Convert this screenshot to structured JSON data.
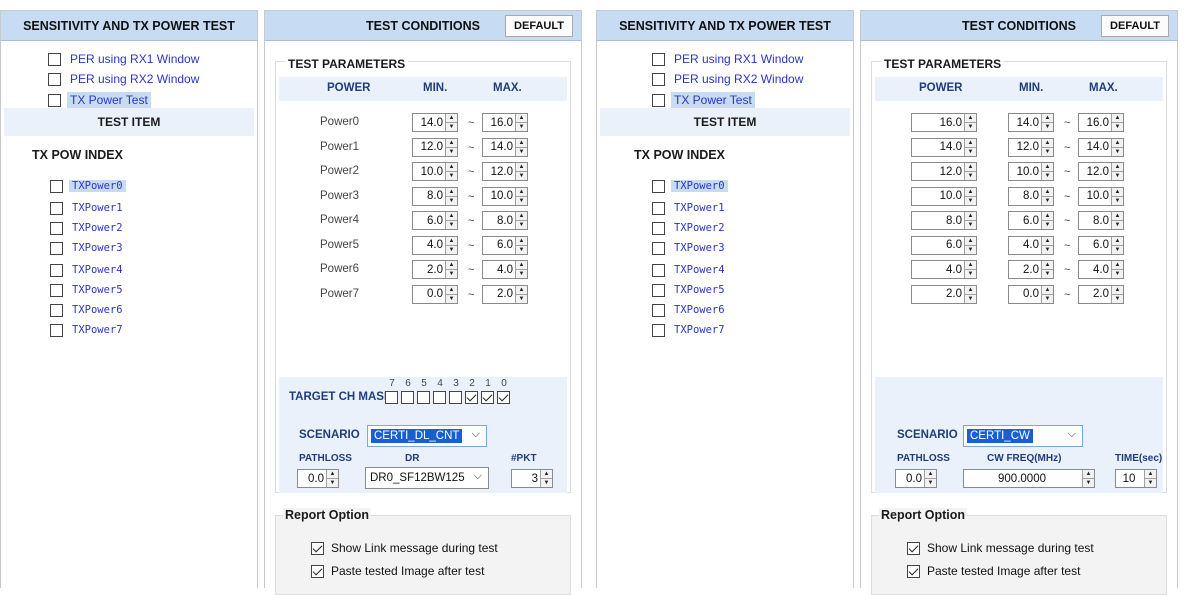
{
  "panes": [
    {
      "id": "a",
      "left_header": "SENSITIVITY AND TX POWER TEST",
      "test_options": [
        {
          "label": "PER using RX1 Window",
          "checked": false,
          "selected": false
        },
        {
          "label": "PER using RX2 Window",
          "checked": false,
          "selected": false
        },
        {
          "label": "TX Power Test",
          "checked": false,
          "selected": true
        }
      ],
      "test_item_header": "TEST ITEM",
      "tx_pow_index_title": "TX POW INDEX",
      "tx_items": [
        {
          "label": "TXPower0",
          "checked": false,
          "selected": true
        },
        {
          "label": "TXPower1",
          "checked": false,
          "selected": false
        },
        {
          "label": "TXPower2",
          "checked": false,
          "selected": false
        },
        {
          "label": "TXPower3",
          "checked": false,
          "selected": false
        },
        {
          "label": "TXPower4",
          "checked": false,
          "selected": false
        },
        {
          "label": "TXPower5",
          "checked": false,
          "selected": false
        },
        {
          "label": "TXPower6",
          "checked": false,
          "selected": false
        },
        {
          "label": "TXPower7",
          "checked": false,
          "selected": false
        }
      ],
      "right_header": "TEST CONDITIONS",
      "default_button": "DEFAULT",
      "params_title": "TEST PARAMETERS",
      "col_power": "POWER",
      "col_min": "MIN.",
      "col_max": "MAX.",
      "power_rows": [
        {
          "name": "Power0",
          "min": "14.0",
          "max": "16.0"
        },
        {
          "name": "Power1",
          "min": "12.0",
          "max": "14.0"
        },
        {
          "name": "Power2",
          "min": "10.0",
          "max": "12.0"
        },
        {
          "name": "Power3",
          "min": "8.0",
          "max": "10.0"
        },
        {
          "name": "Power4",
          "min": "6.0",
          "max": "8.0"
        },
        {
          "name": "Power5",
          "min": "4.0",
          "max": "6.0"
        },
        {
          "name": "Power6",
          "min": "2.0",
          "max": "4.0"
        },
        {
          "name": "Power7",
          "min": "0.0",
          "max": "2.0"
        }
      ],
      "tilde": "~",
      "target_ch_mask_label": "TARGET CH MASK",
      "mask_bits": [
        {
          "num": "7",
          "checked": false
        },
        {
          "num": "6",
          "checked": false
        },
        {
          "num": "5",
          "checked": false
        },
        {
          "num": "4",
          "checked": false
        },
        {
          "num": "3",
          "checked": false
        },
        {
          "num": "2",
          "checked": true
        },
        {
          "num": "1",
          "checked": true
        },
        {
          "num": "0",
          "checked": true
        }
      ],
      "scenario_label": "SCENARIO",
      "scenario_value": "CERTI_DL_CNT",
      "pathloss_label": "PATHLOSS",
      "pathloss_value": "0.0",
      "dr_label": "DR",
      "dr_value": "DR0_SF12BW125",
      "pkt_label": "#PKT",
      "pkt_value": "3",
      "report_title": "Report Option",
      "report_options": [
        {
          "label": "Show Link message during test",
          "checked": true
        },
        {
          "label": "Paste tested Image after test",
          "checked": true
        }
      ]
    },
    {
      "id": "b",
      "left_header": "SENSITIVITY AND TX POWER TEST",
      "test_options": [
        {
          "label": "PER using RX1 Window",
          "checked": false,
          "selected": false
        },
        {
          "label": "PER using RX2 Window",
          "checked": false,
          "selected": false
        },
        {
          "label": "TX Power Test",
          "checked": false,
          "selected": true
        }
      ],
      "test_item_header": "TEST ITEM",
      "tx_pow_index_title": "TX POW INDEX",
      "tx_items": [
        {
          "label": "TXPower0",
          "checked": false,
          "selected": true
        },
        {
          "label": "TXPower1",
          "checked": false,
          "selected": false
        },
        {
          "label": "TXPower2",
          "checked": false,
          "selected": false
        },
        {
          "label": "TXPower3",
          "checked": false,
          "selected": false
        },
        {
          "label": "TXPower4",
          "checked": false,
          "selected": false
        },
        {
          "label": "TXPower5",
          "checked": false,
          "selected": false
        },
        {
          "label": "TXPower6",
          "checked": false,
          "selected": false
        },
        {
          "label": "TXPower7",
          "checked": false,
          "selected": false
        }
      ],
      "right_header": "TEST CONDITIONS",
      "default_button": "DEFAULT",
      "params_title": "TEST PARAMETERS",
      "col_power": "POWER",
      "col_min": "MIN.",
      "col_max": "MAX.",
      "power_rows": [
        {
          "power": "16.0",
          "min": "14.0",
          "max": "16.0"
        },
        {
          "power": "14.0",
          "min": "12.0",
          "max": "14.0"
        },
        {
          "power": "12.0",
          "min": "10.0",
          "max": "12.0"
        },
        {
          "power": "10.0",
          "min": "8.0",
          "max": "10.0"
        },
        {
          "power": "8.0",
          "min": "6.0",
          "max": "8.0"
        },
        {
          "power": "6.0",
          "min": "4.0",
          "max": "6.0"
        },
        {
          "power": "4.0",
          "min": "2.0",
          "max": "4.0"
        },
        {
          "power": "2.0",
          "min": "0.0",
          "max": "2.0"
        }
      ],
      "tilde": "~",
      "scenario_label": "SCENARIO",
      "scenario_value": "CERTI_CW",
      "pathloss_label": "PATHLOSS",
      "pathloss_value": "0.0",
      "cw_freq_label": "CW FREQ(MHz)",
      "cw_freq_value": "900.0000",
      "time_label": "TIME(sec)",
      "time_value": "10",
      "report_title": "Report Option",
      "report_options": [
        {
          "label": "Show Link message during test",
          "checked": true
        },
        {
          "label": "Paste tested Image after test",
          "checked": true
        }
      ]
    }
  ]
}
